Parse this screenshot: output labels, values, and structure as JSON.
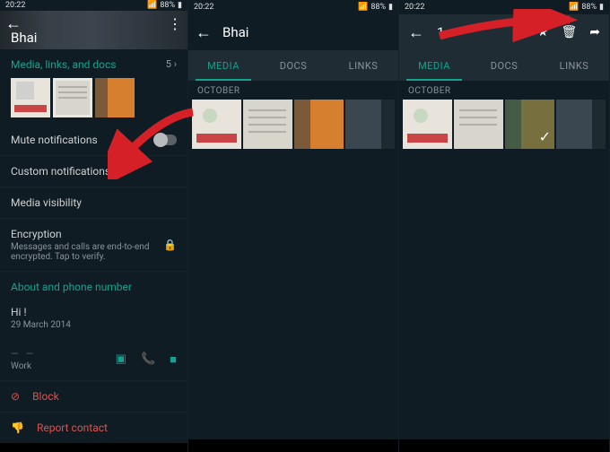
{
  "status": {
    "time": "20:22",
    "battery_pct": "88%"
  },
  "panel1": {
    "contact_name": "Bhai",
    "section_media": "Media, links, and docs",
    "media_count": "5 ›",
    "mute": "Mute notifications",
    "custom": "Custom notifications",
    "visibility": "Media visibility",
    "encryption": "Encryption",
    "encryption_sub": "Messages and calls are end-to-end encrypted. Tap to verify.",
    "about_section": "About and phone number",
    "about_text": "Hi !",
    "about_date": "29 March 2014",
    "phone_label": "Work",
    "block": "Block",
    "report": "Report contact"
  },
  "panel2": {
    "title": "Bhai",
    "tabs": {
      "media": "MEDIA",
      "docs": "DOCS",
      "links": "LINKS"
    },
    "month": "OCTOBER"
  },
  "panel3": {
    "selected_count": "1",
    "tabs": {
      "media": "MEDIA",
      "docs": "DOCS",
      "links": "LINKS"
    },
    "month": "OCTOBER"
  },
  "colors": {
    "accent": "#12a28f"
  }
}
